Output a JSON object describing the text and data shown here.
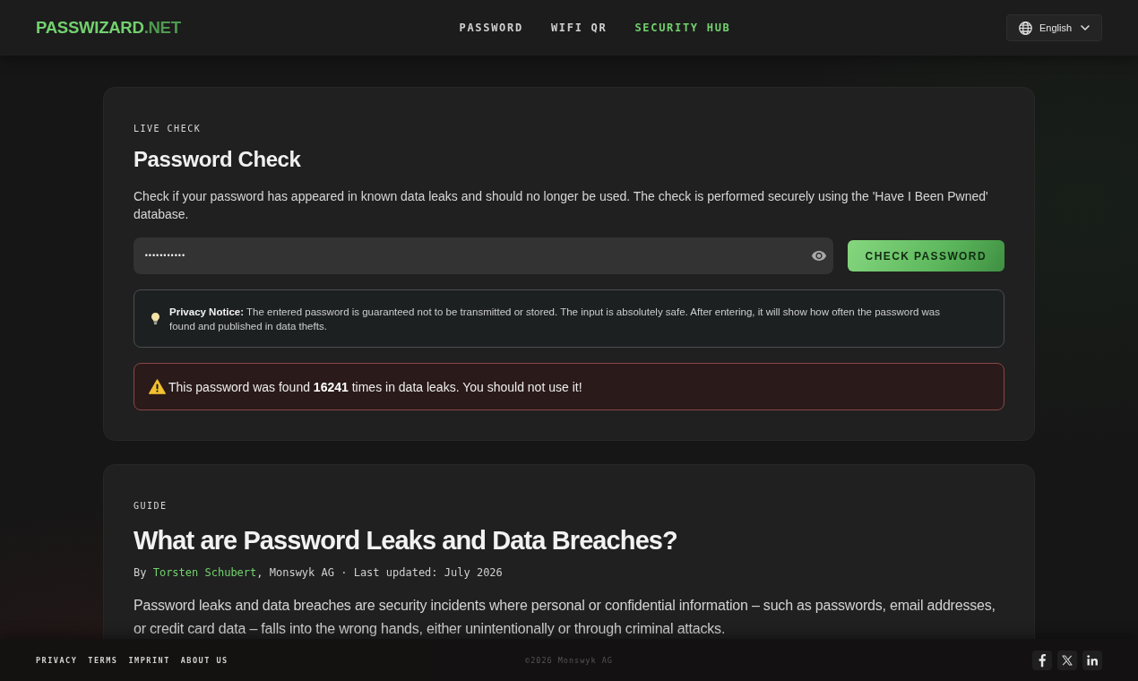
{
  "header": {
    "logo": {
      "name": "PASSWIZARD",
      "suffix": ".NET"
    },
    "nav": [
      {
        "label": "PASSWORD",
        "selected": false
      },
      {
        "label": "WIFI QR",
        "selected": false
      },
      {
        "label": "SECURITY HUB",
        "selected": true
      }
    ],
    "language": "English"
  },
  "check_card": {
    "eyebrow": "LIVE CHECK",
    "title": "Password Check",
    "description": "Check if your password has appeared in known data leaks and should no longer be used. The check is performed securely using the 'Have I Been Pwned' database.",
    "password_field": {
      "value": "•••••••••••"
    },
    "button": "CHECK PASSWORD",
    "privacy_notice": "**Privacy Notice:** The entered password is guaranteed not to be transmitted or stored. The input is absolutely safe. After entering, it will show how often the password was found and published in data thefts.",
    "alert": {
      "kind": "warning",
      "text": "This password was found **16241** times in data leaks. You should not use it!"
    }
  },
  "guide": {
    "eyebrow": "GUIDE",
    "title": "What are Password Leaks and Data Breaches?",
    "byline": {
      "prefix": "By",
      "author": "Torsten Schubert",
      "suffix": ", Monswyk AG · Last updated: July 2026"
    },
    "paragraph": "Password leaks and data breaches are security incidents where personal or confidential information – such as passwords, email addresses, or credit card data – falls into the wrong hands, either unintentionally or through criminal attacks."
  },
  "footer": {
    "links": [
      "PRIVACY",
      "TERMS",
      "IMPRINT",
      "ABOUT US"
    ],
    "copyright": "©2026 Monswyk AG"
  }
}
